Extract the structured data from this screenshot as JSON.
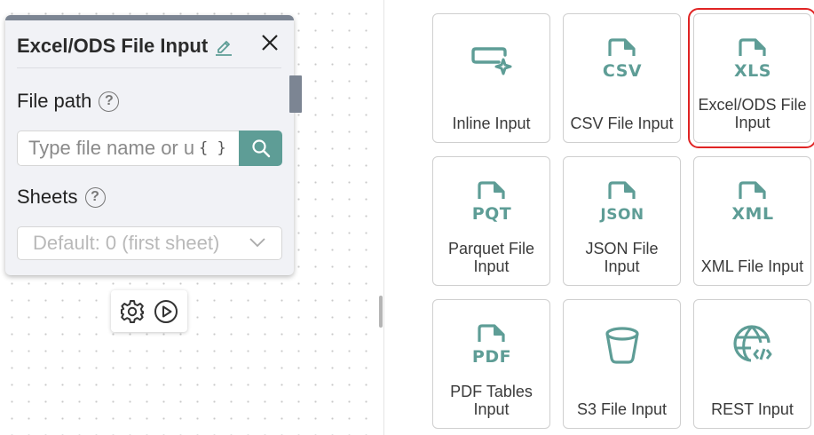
{
  "node": {
    "title": "Excel/ODS File Input",
    "file_path_label": "File path",
    "file_path_placeholder": "Type file name or u",
    "file_path_value": "",
    "variable_braces": "{ }",
    "sheets_label": "Sheets",
    "sheets_value": "Default: 0 (first sheet)"
  },
  "help_glyph": "?",
  "palette": [
    {
      "id": "inline",
      "label": "Inline Input",
      "icon": "inline-input-icon"
    },
    {
      "id": "csv",
      "label": "CSV File Input",
      "icon": "csv-file-icon",
      "badge": "CSV"
    },
    {
      "id": "excel",
      "label": "Excel/ODS File Input",
      "icon": "xls-file-icon",
      "badge": "XLS",
      "selected": true
    },
    {
      "id": "parquet",
      "label": "Parquet File Input",
      "icon": "pqt-file-icon",
      "badge": "PQT"
    },
    {
      "id": "json",
      "label": "JSON File Input",
      "icon": "json-file-icon",
      "badge": "JSON"
    },
    {
      "id": "xml",
      "label": "XML File Input",
      "icon": "xml-file-icon",
      "badge": "XML"
    },
    {
      "id": "pdf",
      "label": "PDF Tables Input",
      "icon": "pdf-file-icon",
      "badge": "PDF"
    },
    {
      "id": "s3",
      "label": "S3 File Input",
      "icon": "bucket-icon"
    },
    {
      "id": "rest",
      "label": "REST Input",
      "icon": "globe-code-icon"
    }
  ],
  "colors": {
    "accent": "#5e9d96",
    "selection": "#e02424",
    "node_header": "#7c8593"
  }
}
